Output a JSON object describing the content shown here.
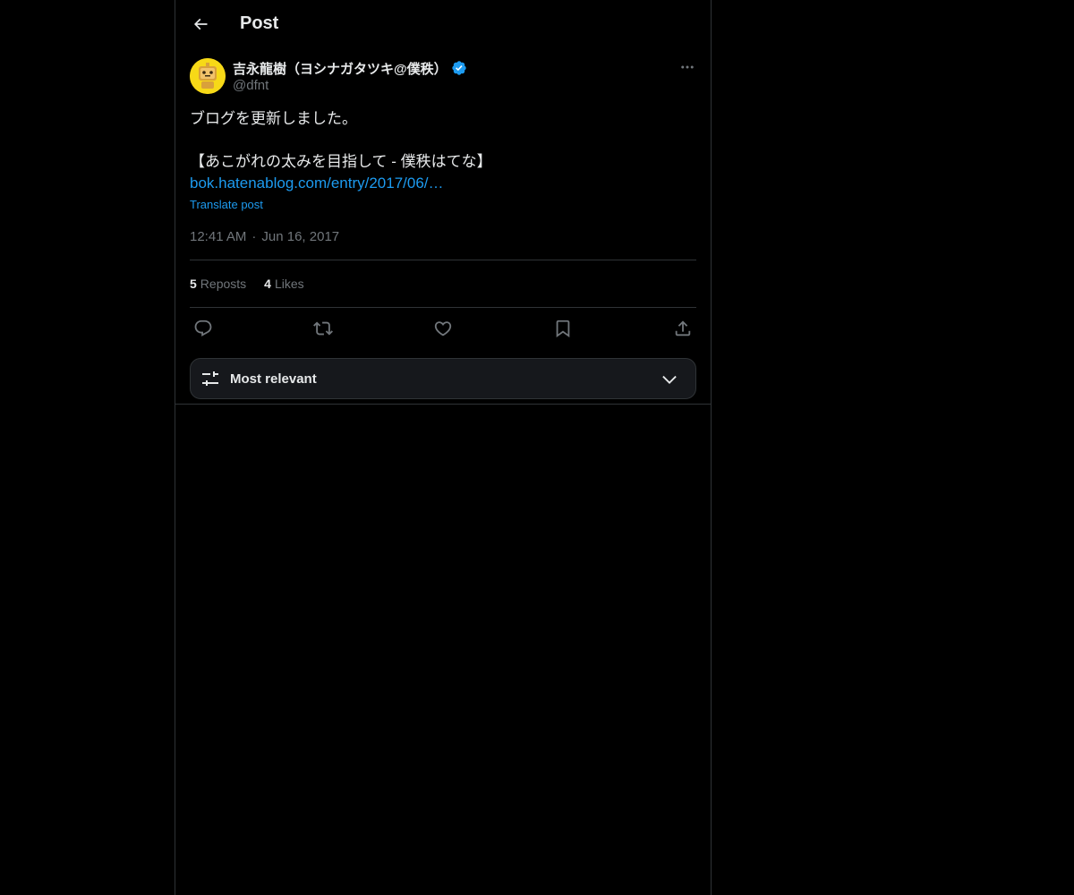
{
  "header": {
    "title": "Post",
    "back_icon": "arrow-left-icon"
  },
  "author": {
    "display_name": "吉永龍樹（ヨシナガタツキ@僕秩）",
    "handle": "@dfnt",
    "verified": true,
    "avatar_color": "#f7d917"
  },
  "post": {
    "text": "ブログを更新しました。\n\n【あこがれの太みを目指して - 僕秩はてな】",
    "link": "bok.hatenablog.com/entry/2017/06/…",
    "translate_label": "Translate post",
    "time": "12:41 AM",
    "date": "Jun 16, 2017",
    "dot": "·"
  },
  "stats": {
    "reposts_count": "5",
    "reposts_label": "Reposts",
    "likes_count": "4",
    "likes_label": "Likes"
  },
  "actions": [
    "reply-icon",
    "repost-icon",
    "like-icon",
    "bookmark-icon",
    "share-icon"
  ],
  "sort": {
    "label": "Most relevant"
  },
  "colors": {
    "accent": "#1d9bf0",
    "background": "#000000",
    "muted": "#71767b",
    "border": "#2f3336"
  }
}
